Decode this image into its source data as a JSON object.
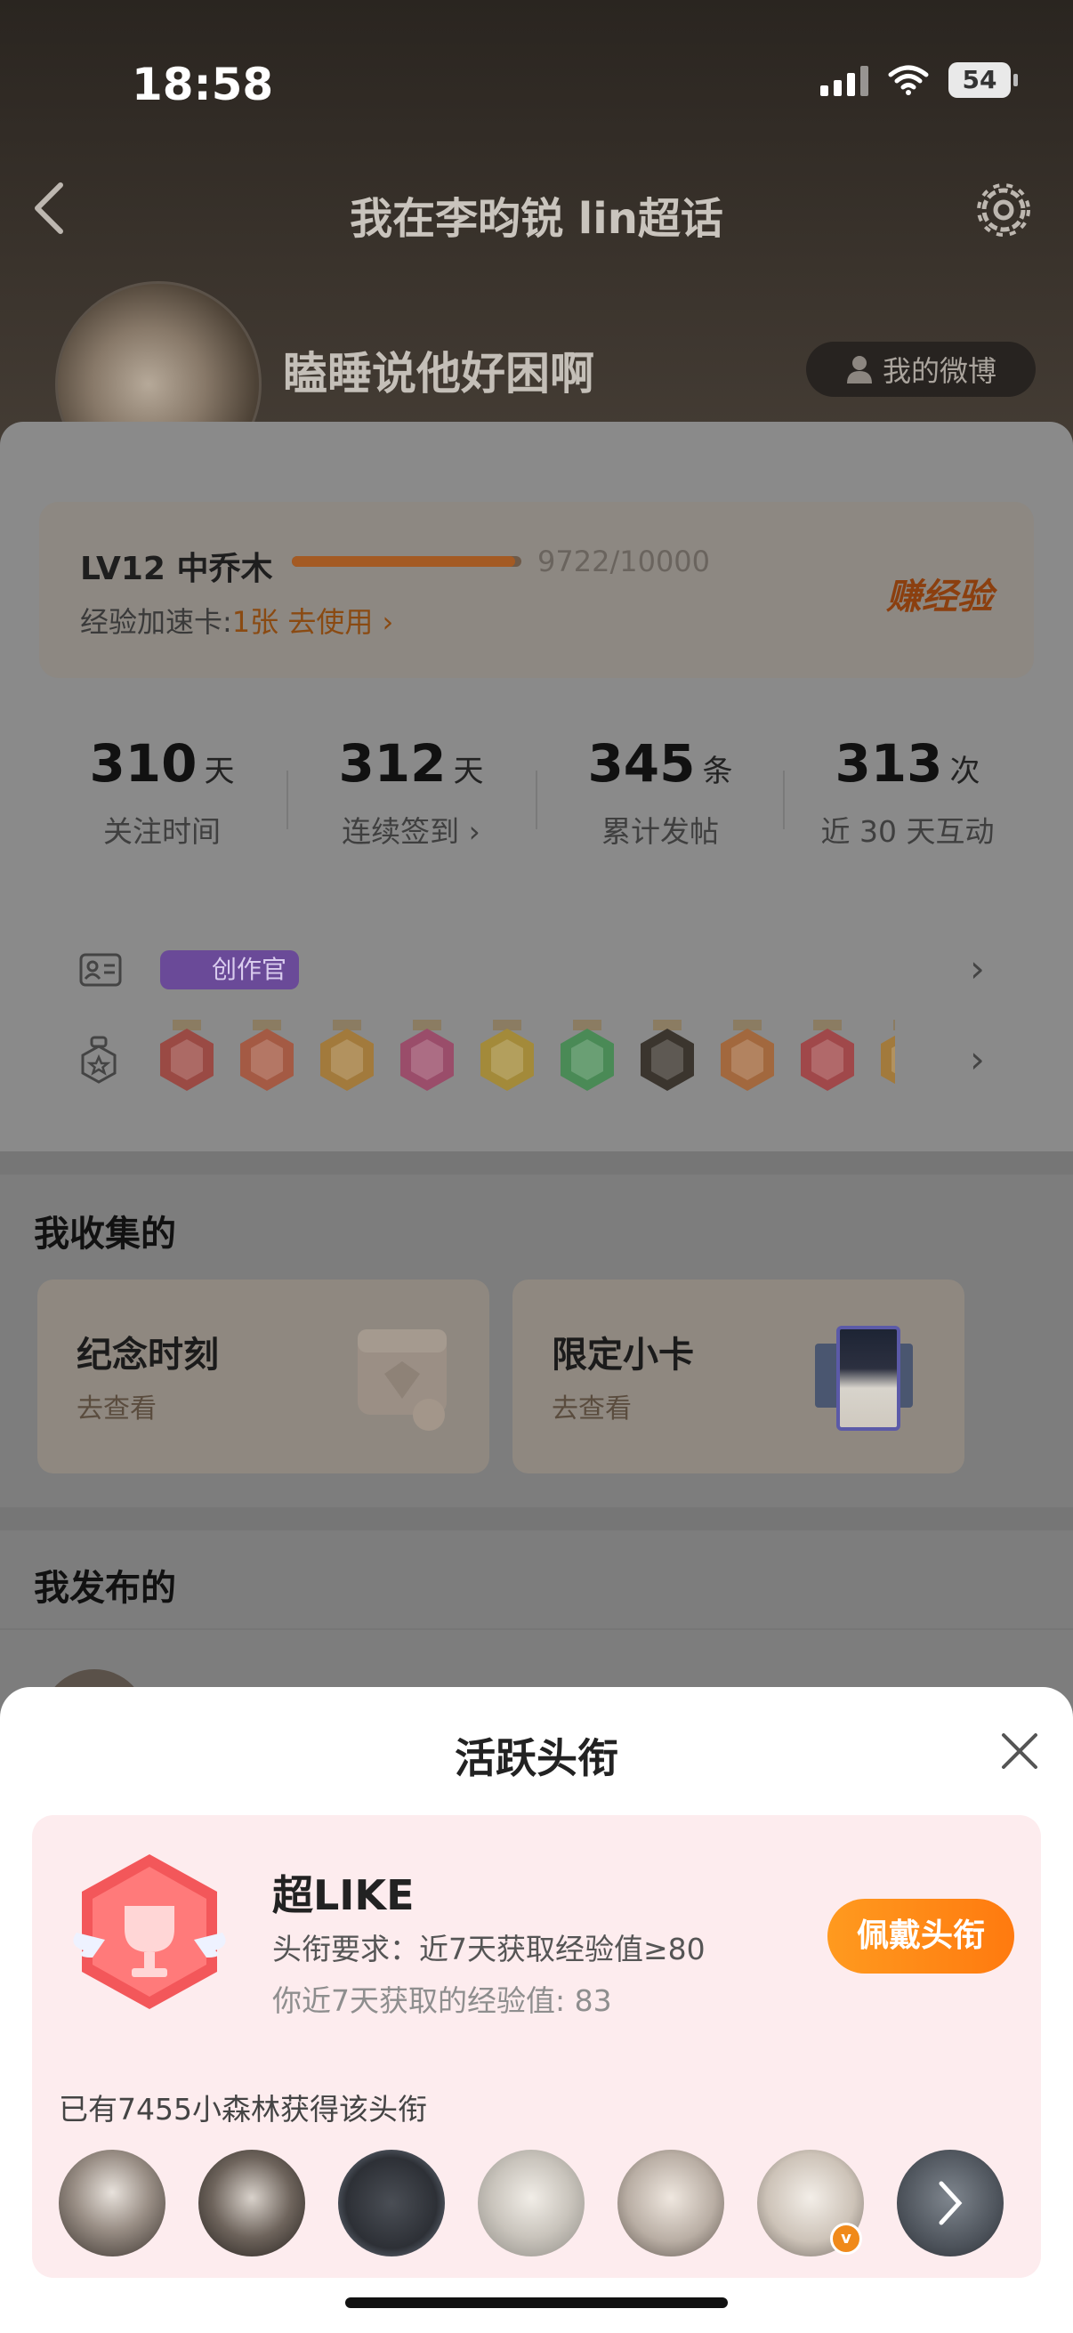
{
  "status_bar": {
    "time": "18:58",
    "battery": "54"
  },
  "nav": {
    "title": "我在李昀锐 lin超话"
  },
  "profile": {
    "username": "瞌睡说他好困啊",
    "my_weibo_label": "我的微博"
  },
  "level": {
    "label": "LV12 中乔木",
    "progress_text": "9722/10000",
    "progress_fraction": 0.9722,
    "accel_prefix": "经验加速卡:",
    "accel_highlight": "1张 去使用 ›",
    "earn_label": "赚经验"
  },
  "stats": [
    {
      "num": "310",
      "unit": "天",
      "label": "关注时间"
    },
    {
      "num": "312",
      "unit": "天",
      "label": "连续签到 ›"
    },
    {
      "num": "345",
      "unit": "条",
      "label": "累计发帖"
    },
    {
      "num": "313",
      "unit": "次",
      "label": "近 30 天互动"
    }
  ],
  "badges": {
    "creator_tag": "创作官"
  },
  "collections": {
    "title": "我收集的",
    "cards": [
      {
        "title": "纪念时刻",
        "sub": "去查看"
      },
      {
        "title": "限定小卡",
        "sub": "去查看"
      }
    ]
  },
  "posted": {
    "title": "我发布的"
  },
  "sheet": {
    "title": "活跃头衔",
    "badge_name": "超LIKE",
    "requirement": "头衔要求：近7天获取经验值≥80",
    "my_exp": "你近7天获取的经验值: 83",
    "wear_button": "佩戴头衔",
    "owners_text": "已有7455小森林获得该头衔"
  },
  "colors": {
    "accent": "#ff8a14",
    "badge_pink": "#f25a5a",
    "card_bg": "#fdecee"
  }
}
